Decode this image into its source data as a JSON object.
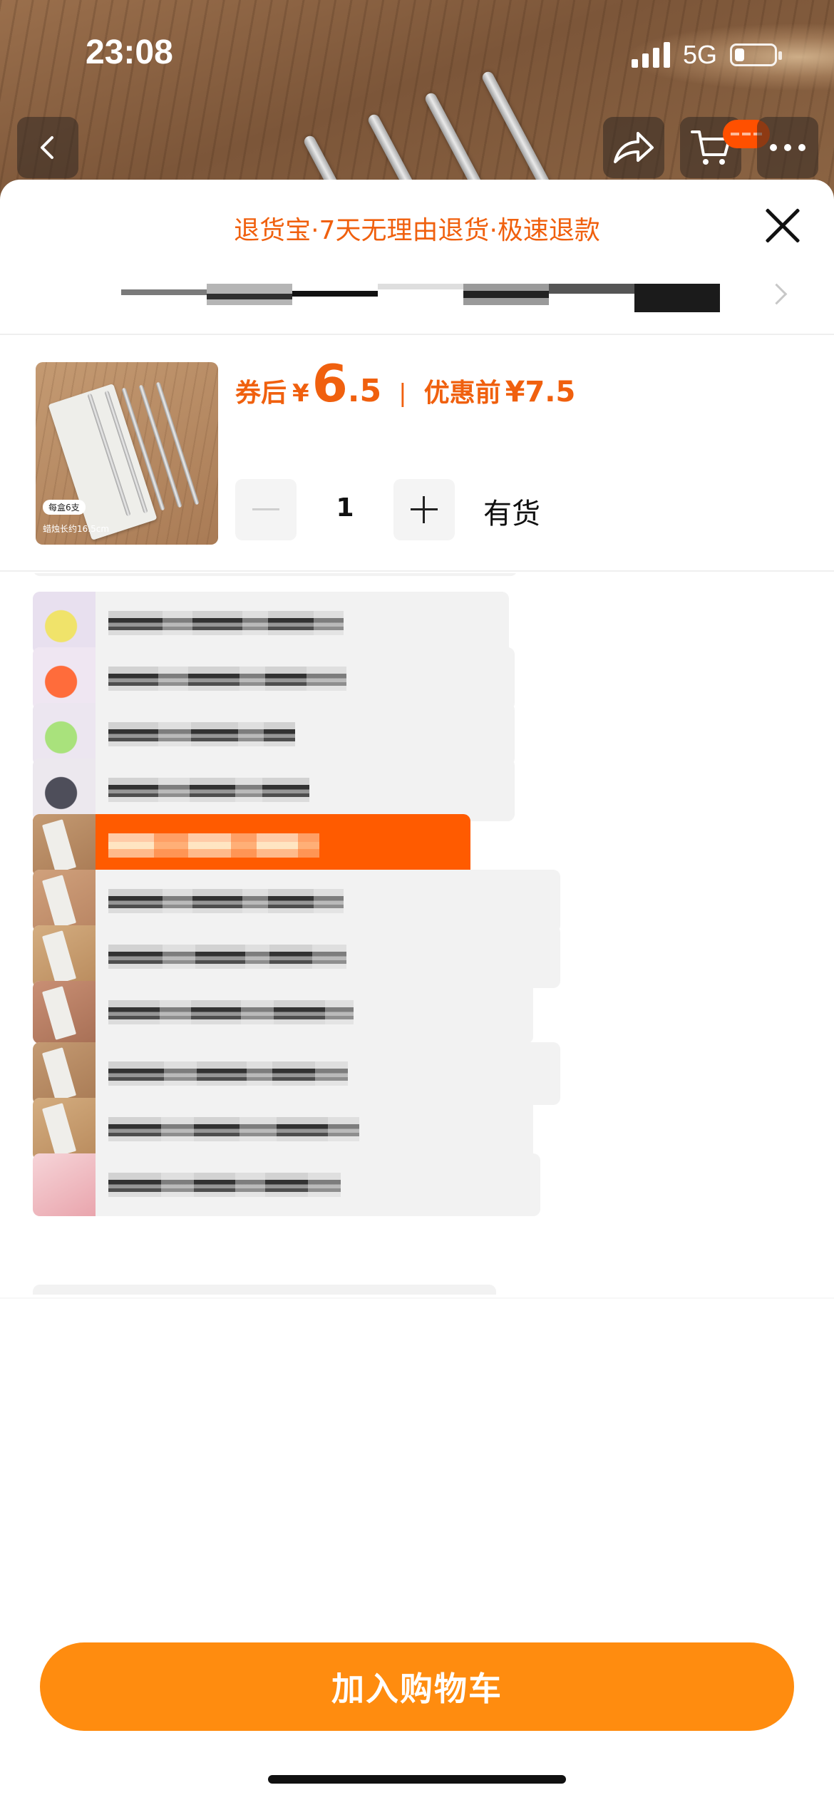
{
  "status_bar": {
    "time": "23:08",
    "network": "5G",
    "battery_level": 0.25
  },
  "header": {
    "back_icon": "chevron-left-icon",
    "share_icon": "share-arrow-icon",
    "cart_icon": "cart-icon",
    "more_icon": "more-dots-icon"
  },
  "sheet": {
    "guarantee": "退货宝·7天无理由退货·极速退款",
    "close_icon": "close-icon"
  },
  "product": {
    "thumb_tag": "每盒6支",
    "thumb_note": "蜡烛长约16.5cm",
    "price_label": "券后",
    "currency": "¥",
    "price_int": "6",
    "price_dec": ".5",
    "separator": "|",
    "original_label": "优惠前",
    "original_price": "¥7.5",
    "quantity": "1",
    "stock_label": "有货"
  },
  "options": [
    {
      "thumb": "ribbon-yellow",
      "selected": false
    },
    {
      "thumb": "ribbon-orange",
      "selected": false
    },
    {
      "thumb": "ribbon-green",
      "selected": false
    },
    {
      "thumb": "ribbon-gray",
      "selected": false
    },
    {
      "thumb": "candle-silver",
      "selected": true
    },
    {
      "thumb": "candle-pink",
      "selected": false
    },
    {
      "thumb": "candle-gold",
      "selected": false
    },
    {
      "thumb": "candle-rose",
      "selected": false
    },
    {
      "thumb": "candle-silver",
      "selected": false
    },
    {
      "thumb": "candle-gold",
      "selected": false
    },
    {
      "thumb": "pink-box",
      "selected": false
    }
  ],
  "footer": {
    "add_to_cart": "加入购物车"
  },
  "colors": {
    "accent_orange": "#f0600e",
    "cta_orange": "#ff8c0f",
    "selected_option": "#ff5b00"
  }
}
